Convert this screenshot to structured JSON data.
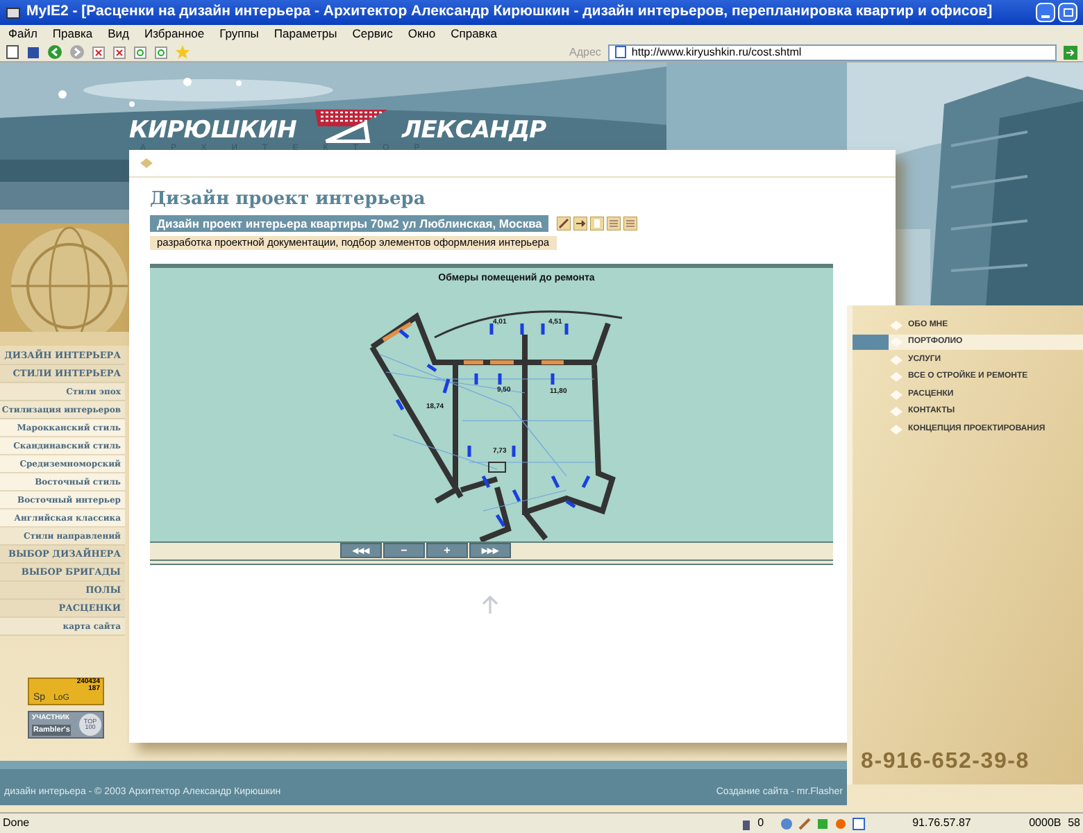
{
  "window": {
    "title": "MyIE2 - [Расценки на дизайн интерьера - Архитектор Александр Кирюшкин - дизайн интерьеров, перепланировка квартир и офисов]"
  },
  "menu": [
    "Файл",
    "Правка",
    "Вид",
    "Избранное",
    "Группы",
    "Параметры",
    "Сервис",
    "Окно",
    "Справка"
  ],
  "address": {
    "label": "Адрес",
    "value": "http://www.kiryushkin.ru/cost.shtml"
  },
  "logo": {
    "surname": "КИРЮШКИН",
    "name": "ЛЕКСАНДР",
    "profession": "АРХИТЕКТОР"
  },
  "sidebar": {
    "items": [
      {
        "label": "ДИЗАЙН ИНТЕРЬЕРА",
        "kind": "main"
      },
      {
        "label": "СТИЛИ ИНТЕРЬЕРА",
        "kind": "main"
      },
      {
        "label": "Стили эпох",
        "kind": "sub"
      },
      {
        "label": "Стилизация интерьеров",
        "kind": "sub"
      },
      {
        "label": "Марокканский стиль",
        "kind": "subsub"
      },
      {
        "label": "Скандинавский стиль",
        "kind": "subsub"
      },
      {
        "label": "Средиземноморский",
        "kind": "subsub"
      },
      {
        "label": "Восточный стиль",
        "kind": "subsub"
      },
      {
        "label": "Восточный интерьер",
        "kind": "subsub"
      },
      {
        "label": "Английская классика",
        "kind": "subsub"
      },
      {
        "label": "Стили направлений",
        "kind": "sub"
      },
      {
        "label": "ВЫБОР ДИЗАЙНЕРА",
        "kind": "main"
      },
      {
        "label": "ВЫБОР БРИГАДЫ",
        "kind": "main"
      },
      {
        "label": "ПОЛЫ",
        "kind": "main"
      },
      {
        "label": "РАСЦЕНКИ",
        "kind": "main"
      },
      {
        "label": "карта сайта",
        "kind": "sub"
      }
    ]
  },
  "counters": {
    "hits": "240434",
    "today": "187",
    "logo_left": "Sp",
    "logo_right": "LoG",
    "member": "УЧАСТНИК",
    "rambler": "Rambler's",
    "top": "TOP",
    "top_num": "100"
  },
  "content": {
    "heading": "Дизайн проект интерьера",
    "project": "Дизайн проект интерьера квартиры 70м2 ул Люблинская, Москва",
    "description": "разработка проектной документации, подбор элементов оформления интерьера",
    "plan": {
      "caption": "Обмеры помещений до ремонта",
      "rooms": [
        "4,01",
        "4,51",
        "18,74",
        "9,50",
        "11,80",
        "7,73"
      ]
    },
    "controls": [
      "◂◂◂",
      "−",
      "+",
      "▸▸▸"
    ]
  },
  "right_menu": [
    {
      "label": "ОБО МНЕ",
      "selected": false
    },
    {
      "label": "ПОРТФОЛИО",
      "selected": true
    },
    {
      "label": "УСЛУГИ",
      "selected": false
    },
    {
      "label": "ВСЕ О СТРОЙКЕ И РЕМОНТЕ",
      "selected": false
    },
    {
      "label": "РАСЦЕНКИ",
      "selected": false
    },
    {
      "label": "КОНТАКТЫ",
      "selected": false
    },
    {
      "label": "КОНЦЕПЦИЯ ПРОЕКТИРОВАНИЯ",
      "selected": false
    }
  ],
  "phone": "8-916-652-39-8",
  "footer": {
    "copyright": "дизайн интерьера - © 2003 Архитектор Александр Кирюшкин",
    "credit": "Создание сайта - mr.Flasher"
  },
  "status_bar": {
    "text": "Done",
    "count": "0",
    "ip": "91.76.57.87",
    "bytes": "0000B",
    "extra": "58"
  }
}
